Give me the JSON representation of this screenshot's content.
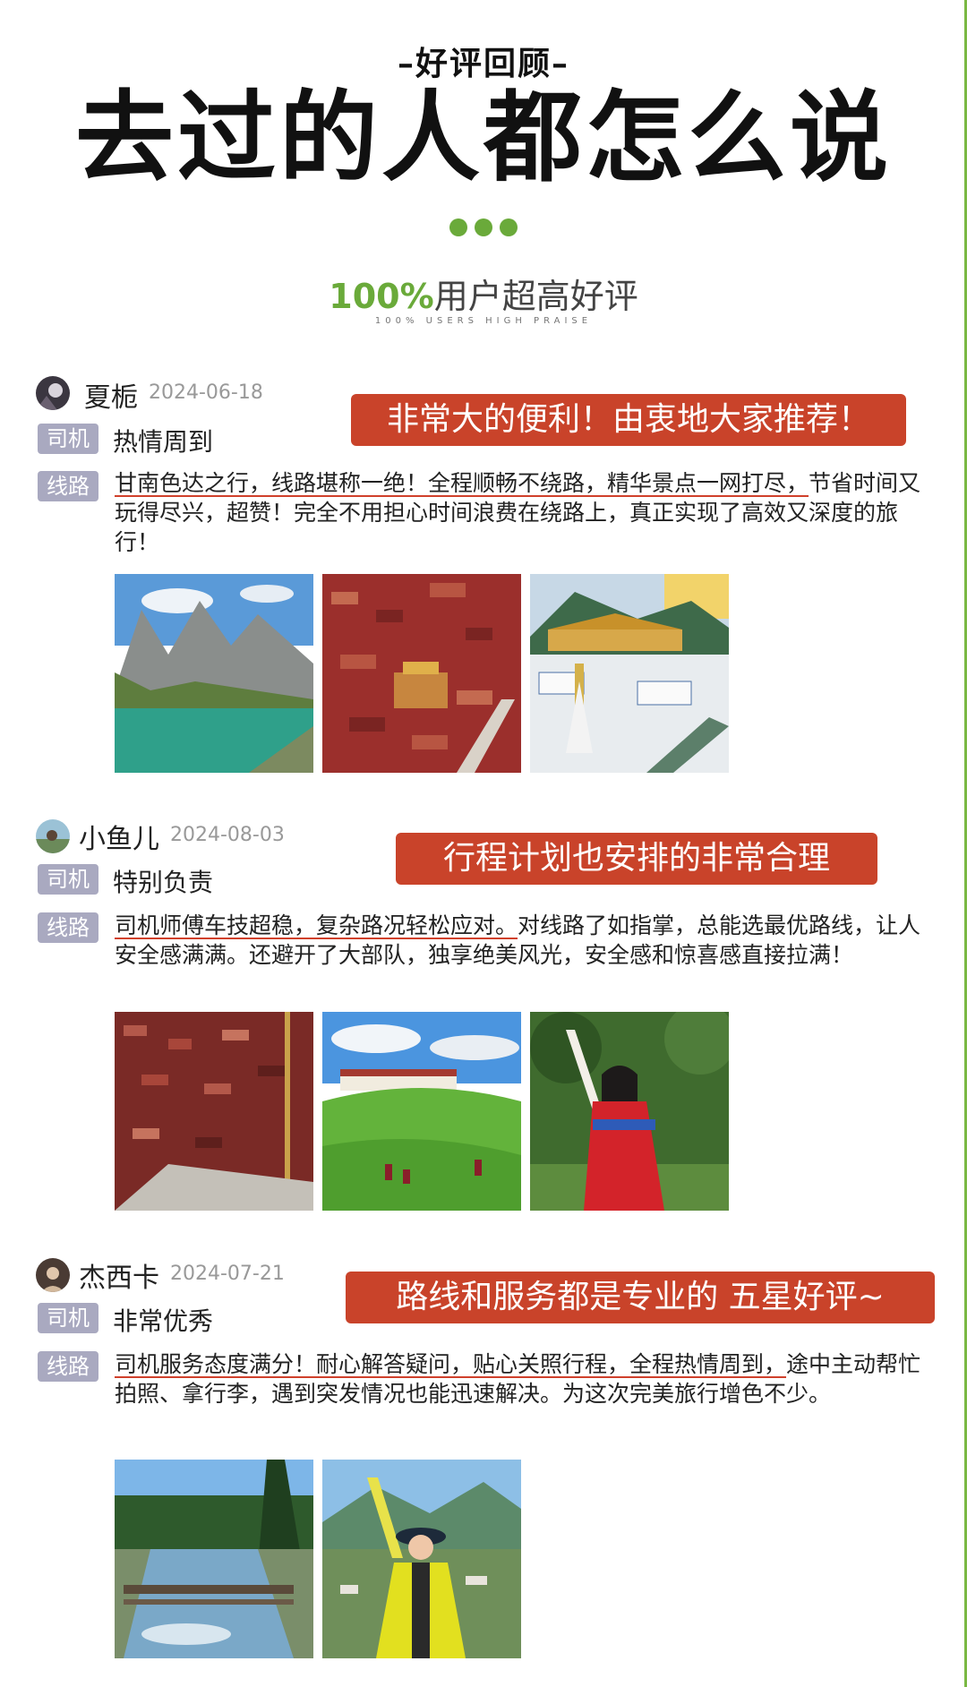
{
  "header": {
    "kicker": "–好评回顾–",
    "title": "去过的人都怎么说",
    "praise_pct": "100%",
    "praise_text": "用户超高好评",
    "praise_sub": "100% USERS HIGH PRAISE"
  },
  "labels": {
    "driver": "司机",
    "route": "线路"
  },
  "reviews": [
    {
      "name": "夏栀",
      "date": "2024-06-18",
      "banner": "非常大的便利！由衷地大家推荐！",
      "driver": "热情周到",
      "route_highlight": "甘南色达之行，线路堪称一绝！全程顺畅不绕路，精华景点一网打尽，",
      "route_rest": "节省时间又玩得尽兴，超赞！完全不用担心时间浪费在绕路上，真正实现了高效又深度的旅行！",
      "photos": [
        "alpine-lake-photo",
        "monastery-red-houses-photo",
        "tibetan-temple-photo"
      ]
    },
    {
      "name": "小鱼儿",
      "date": "2024-08-03",
      "banner": "行程计划也安排的非常合理",
      "driver": "特别负责",
      "route_highlight": "司机师傅车技超稳，复杂路况轻松应对。",
      "route_rest": "对线路了如指掌，总能选最优路线，让人安全感满满。还避开了大部队，独享绝美风光，安全感和惊喜感直接拉满！",
      "photos": [
        "red-hillside-houses-photo",
        "green-grassland-photo",
        "tibetan-costume-girl-photo"
      ]
    },
    {
      "name": "杰西卡",
      "date": "2024-07-21",
      "banner": "路线和服务都是专业的  五星好评~",
      "driver": "非常优秀",
      "route_highlight": "司机服务态度满分！耐心解答疑问，贴心关照行程，全程热情周到，",
      "route_rest": "途中主动帮忙拍照、拿行李，遇到突发情况也能迅速解决。为这次完美旅行增色不少。",
      "photos": [
        "forest-stream-photo",
        "hiker-yellow-jacket-photo"
      ]
    }
  ]
}
